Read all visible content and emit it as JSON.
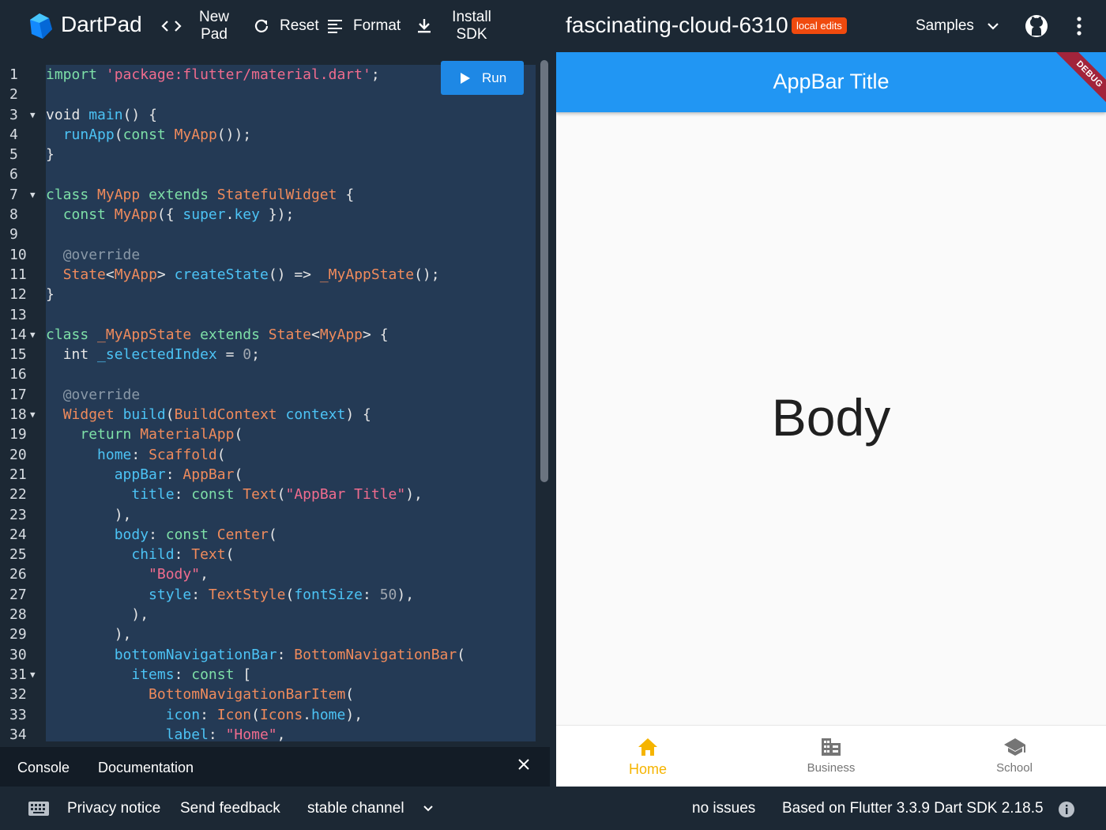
{
  "header": {
    "brand": "DartPad",
    "new_pad": [
      "New",
      "Pad"
    ],
    "reset": "Reset",
    "format": "Format",
    "install_sdk": [
      "Install",
      "SDK"
    ],
    "pad_title": "fascinating-cloud-6310",
    "badge": "local edits",
    "samples": "Samples"
  },
  "editor": {
    "run_label": "Run",
    "line_numbers": [
      "1",
      "2",
      "3",
      "4",
      "5",
      "6",
      "7",
      "8",
      "9",
      "10",
      "11",
      "12",
      "13",
      "14",
      "15",
      "16",
      "17",
      "18",
      "19",
      "20",
      "21",
      "22",
      "23",
      "24",
      "25",
      "26",
      "27",
      "28",
      "29",
      "30",
      "31",
      "32",
      "33",
      "34"
    ]
  },
  "console": {
    "console_tab": "Console",
    "docs_tab": "Documentation"
  },
  "preview": {
    "appbar_title": "AppBar Title",
    "debug_banner": "DEBUG",
    "body": "Body",
    "nav_items": [
      {
        "label": "Home",
        "icon": "home-icon"
      },
      {
        "label": "Business",
        "icon": "business-icon"
      },
      {
        "label": "School",
        "icon": "school-icon"
      }
    ]
  },
  "footer": {
    "privacy": "Privacy notice",
    "feedback": "Send feedback",
    "channel": "stable channel",
    "issues": "no issues",
    "version": "Based on Flutter 3.3.9 Dart SDK 2.18.5"
  },
  "colors": {
    "accent": "#2196f3",
    "run_button": "#1e88e5",
    "badge": "#f04a0e",
    "active_nav": "#f5b400"
  }
}
